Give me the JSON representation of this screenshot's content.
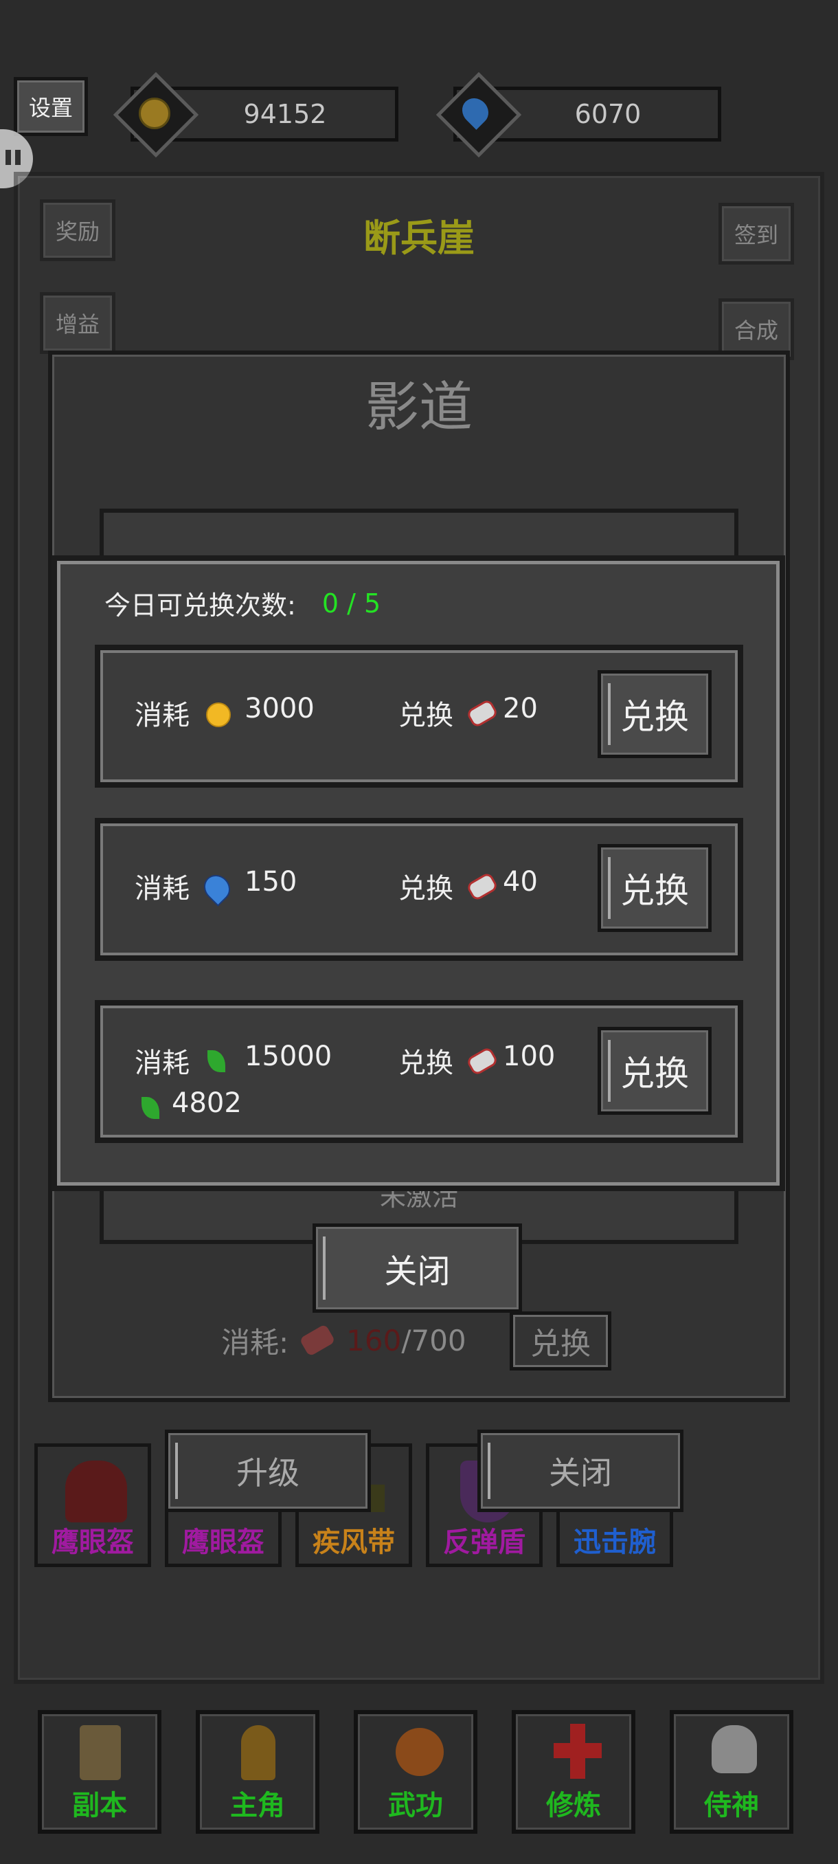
{
  "top_bar": {
    "settings_label": "设置",
    "gold_amount": "94152",
    "water_amount": "6070"
  },
  "scene": {
    "title": "断兵崖",
    "left_buttons": [
      "奖励",
      "增益"
    ],
    "right_buttons": [
      "签到",
      "合成"
    ]
  },
  "shadow_dialog": {
    "title": "影道",
    "peek_text": "未激活",
    "close_label": "关闭",
    "cost_label": "消耗:",
    "cost_current": "160",
    "cost_total": "/700",
    "exchange_label": "兑换"
  },
  "equipment_panel": {
    "upgrade_label": "升级",
    "close_label": "关闭",
    "items": [
      {
        "name": "鹰眼盔",
        "color": "#a01aa0"
      },
      {
        "name": "鹰眼盔",
        "color": "#a01aa0"
      },
      {
        "name": "疾风带",
        "color": "#c8821a"
      },
      {
        "name": "反弹盾",
        "color": "#a01aa0"
      },
      {
        "name": "迅击腕",
        "color": "#1f5fcf"
      }
    ]
  },
  "bottom_nav": [
    {
      "label": "副本",
      "icon": "scroll-icon"
    },
    {
      "label": "主角",
      "icon": "hero-icon"
    },
    {
      "label": "武功",
      "icon": "fireball-icon"
    },
    {
      "label": "修炼",
      "icon": "cross-icon"
    },
    {
      "label": "侍神",
      "icon": "skull-icon"
    }
  ],
  "exchange_dialog": {
    "daily_label": "今日可兑换次数:",
    "daily_count": "0 / 5",
    "rows": [
      {
        "cost_label": "消耗",
        "cost_icon": "gold-coin-icon",
        "cost_value": "3000",
        "get_label": "兑换",
        "get_icon": "scroll-bundle-icon",
        "get_value": "20",
        "button": "兑换",
        "owned_value": ""
      },
      {
        "cost_label": "消耗",
        "cost_icon": "water-drop-icon",
        "cost_value": "150",
        "get_label": "兑换",
        "get_icon": "scroll-bundle-icon",
        "get_value": "40",
        "button": "兑换",
        "owned_value": ""
      },
      {
        "cost_label": "消耗",
        "cost_icon": "green-leaf-icon",
        "cost_value": "15000",
        "get_label": "兑换",
        "get_icon": "scroll-bundle-icon",
        "get_value": "100",
        "button": "兑换",
        "owned_value": "4802"
      }
    ],
    "close_label": "关闭"
  }
}
